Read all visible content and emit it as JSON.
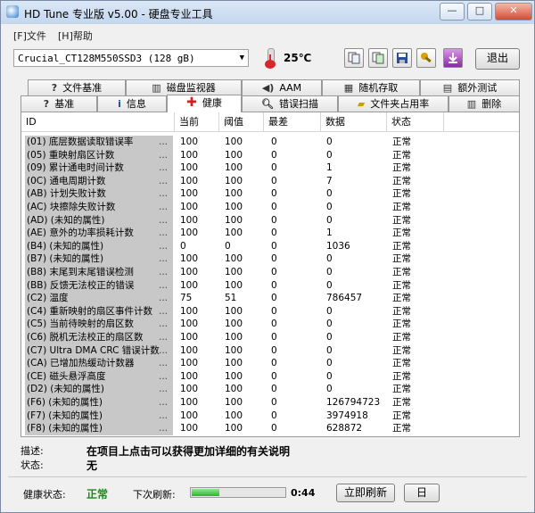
{
  "window": {
    "title": "HD Tune 专业版 v5.00 - 硬盘专业工具",
    "minimize_label": "—",
    "maximize_label": "□",
    "close_label": "✕"
  },
  "menu": {
    "file": "[F]文件",
    "help": "[H]帮助"
  },
  "toolbar": {
    "drive": "Crucial_CT128M550SSD3 (128 gB)",
    "temperature": "25℃",
    "exit_label": "退出",
    "icons": [
      "copy-text-icon",
      "copy-screen-icon",
      "save-icon",
      "options-icon",
      "download-icon"
    ]
  },
  "tabs_top": [
    {
      "label": "文件基准",
      "icon": "file-benchmark-icon"
    },
    {
      "label": "磁盘监视器",
      "icon": "disk-monitor-icon"
    },
    {
      "label": "AAM",
      "icon": "aam-icon"
    },
    {
      "label": "随机存取",
      "icon": "random-access-icon"
    },
    {
      "label": "额外测试",
      "icon": "extra-tests-icon"
    }
  ],
  "tabs_bottom": [
    {
      "label": "基准",
      "icon": "benchmark-icon"
    },
    {
      "label": "信息",
      "icon": "info-icon"
    },
    {
      "label": "健康",
      "icon": "health-icon",
      "active": true
    },
    {
      "label": "错误扫描",
      "icon": "error-scan-icon"
    },
    {
      "label": "文件夹占用率",
      "icon": "folder-usage-icon"
    },
    {
      "label": "删除",
      "icon": "erase-icon"
    }
  ],
  "table": {
    "headers": {
      "id": "ID",
      "current": "当前",
      "threshold": "阈值",
      "worst": "最差",
      "data": "数据",
      "status": "状态"
    },
    "rows": [
      {
        "id": "(01) 底层数据读取错误率",
        "current": "100",
        "threshold": "100",
        "worst": "0",
        "data": "0",
        "status": "正常"
      },
      {
        "id": "(05) 重映射扇区计数",
        "current": "100",
        "threshold": "100",
        "worst": "0",
        "data": "0",
        "status": "正常"
      },
      {
        "id": "(09) 累计通电时间计数",
        "current": "100",
        "threshold": "100",
        "worst": "0",
        "data": "1",
        "status": "正常"
      },
      {
        "id": "(0C) 通电周期计数",
        "current": "100",
        "threshold": "100",
        "worst": "0",
        "data": "7",
        "status": "正常"
      },
      {
        "id": "(AB) 计划失败计数",
        "current": "100",
        "threshold": "100",
        "worst": "0",
        "data": "0",
        "status": "正常"
      },
      {
        "id": "(AC) 块擦除失败计数",
        "current": "100",
        "threshold": "100",
        "worst": "0",
        "data": "0",
        "status": "正常"
      },
      {
        "id": "(AD) (未知的属性)",
        "current": "100",
        "threshold": "100",
        "worst": "0",
        "data": "0",
        "status": "正常"
      },
      {
        "id": "(AE) 意外的功率损耗计数",
        "current": "100",
        "threshold": "100",
        "worst": "0",
        "data": "1",
        "status": "正常"
      },
      {
        "id": "(B4) (未知的属性)",
        "current": "0",
        "threshold": "0",
        "worst": "0",
        "data": "1036",
        "status": "正常"
      },
      {
        "id": "(B7) (未知的属性)",
        "current": "100",
        "threshold": "100",
        "worst": "0",
        "data": "0",
        "status": "正常"
      },
      {
        "id": "(B8) 末尾到末尾错误检测",
        "current": "100",
        "threshold": "100",
        "worst": "0",
        "data": "0",
        "status": "正常"
      },
      {
        "id": "(BB) 反馈无法校正的错误",
        "current": "100",
        "threshold": "100",
        "worst": "0",
        "data": "0",
        "status": "正常"
      },
      {
        "id": "(C2) 温度",
        "current": "75",
        "threshold": "51",
        "worst": "0",
        "data": "786457",
        "status": "正常"
      },
      {
        "id": "(C4) 重新映射的扇区事件计数",
        "current": "100",
        "threshold": "100",
        "worst": "0",
        "data": "0",
        "status": "正常"
      },
      {
        "id": "(C5) 当前待映射的扇区数",
        "current": "100",
        "threshold": "100",
        "worst": "0",
        "data": "0",
        "status": "正常"
      },
      {
        "id": "(C6) 脱机无法校正的扇区数",
        "current": "100",
        "threshold": "100",
        "worst": "0",
        "data": "0",
        "status": "正常"
      },
      {
        "id": "(C7) Ultra DMA CRC 错误计数",
        "current": "100",
        "threshold": "100",
        "worst": "0",
        "data": "0",
        "status": "正常"
      },
      {
        "id": "(CA) 已增加热缓动计数器",
        "current": "100",
        "threshold": "100",
        "worst": "0",
        "data": "0",
        "status": "正常"
      },
      {
        "id": "(CE) 磁头悬浮高度",
        "current": "100",
        "threshold": "100",
        "worst": "0",
        "data": "0",
        "status": "正常"
      },
      {
        "id": "(D2) (未知的属性)",
        "current": "100",
        "threshold": "100",
        "worst": "0",
        "data": "0",
        "status": "正常"
      },
      {
        "id": "(F6) (未知的属性)",
        "current": "100",
        "threshold": "100",
        "worst": "0",
        "data": "126794723",
        "status": "正常"
      },
      {
        "id": "(F7) (未知的属性)",
        "current": "100",
        "threshold": "100",
        "worst": "0",
        "data": "3974918",
        "status": "正常"
      },
      {
        "id": "(F8) (未知的属性)",
        "current": "100",
        "threshold": "100",
        "worst": "0",
        "data": "628872",
        "status": "正常"
      }
    ]
  },
  "info": {
    "desc_label": "描述:",
    "desc_text": "在项目上点击可以获得更加详细的有关说明",
    "status_label": "状态:",
    "status_text": "无"
  },
  "footer": {
    "health_label": "健康状态:",
    "health_value": "正常",
    "next_refresh_label": "下次刷新:",
    "refresh_progress": 0.3,
    "time": "0:44",
    "refresh_now_label": "立即刷新",
    "log_label": "日"
  },
  "colors": {
    "health_ok": "#1a8a1a",
    "progress": "#2fb12f"
  }
}
